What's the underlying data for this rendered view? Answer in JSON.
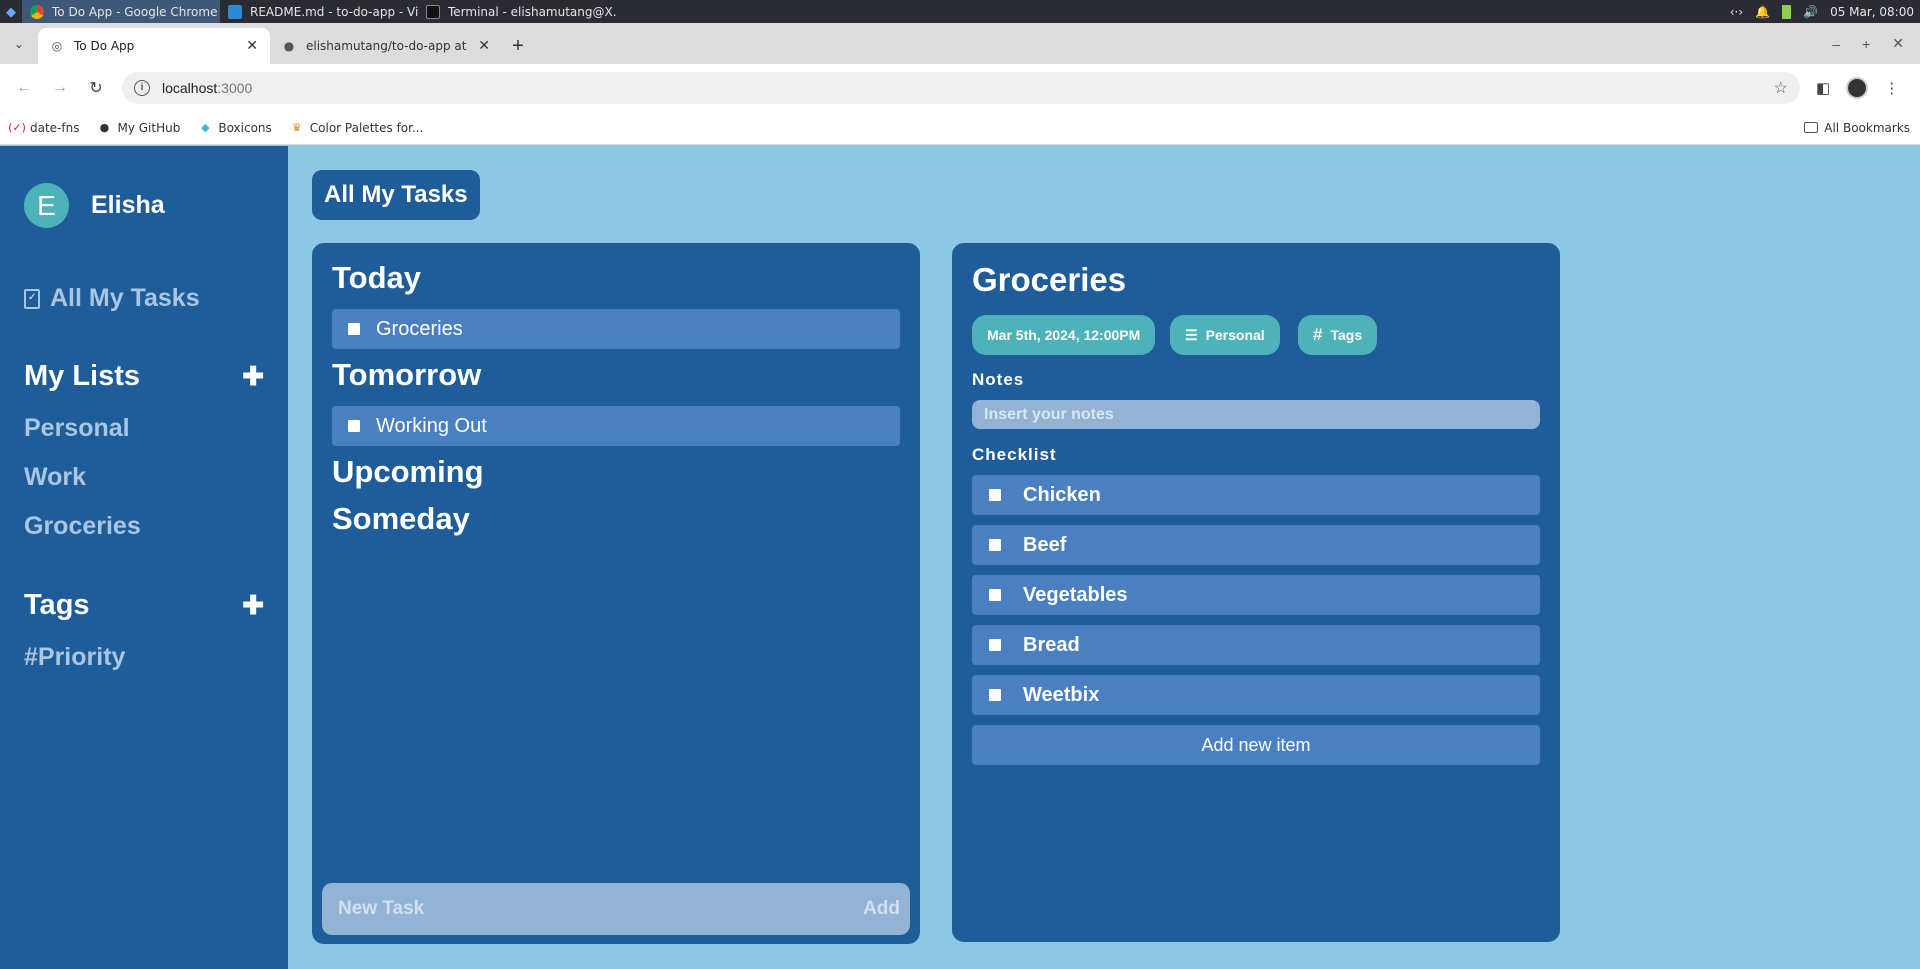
{
  "os": {
    "tasks": [
      {
        "label": "To Do App - Google Chrome",
        "icon": "chrome-icon",
        "active": true
      },
      {
        "label": "README.md - to-do-app - Vi...",
        "icon": "vscode-icon",
        "active": false
      },
      {
        "label": "Terminal - elishamutang@X...",
        "icon": "terminal-icon",
        "active": false
      }
    ],
    "datetime": "05 Mar, 08:00"
  },
  "browser": {
    "tabs": [
      {
        "title": "To Do App",
        "active": true
      },
      {
        "title": "elishamutang/to-do-app at ad",
        "active": false
      }
    ],
    "url_host": "localhost",
    "url_rest": ":3000",
    "bookmarks": [
      {
        "label": "date-fns",
        "icon": "date-fns-icon"
      },
      {
        "label": "My GitHub",
        "icon": "github-icon"
      },
      {
        "label": "Boxicons",
        "icon": "boxicons-icon"
      },
      {
        "label": "Color Palettes for...",
        "icon": "palette-icon"
      }
    ],
    "all_bookmarks": "All Bookmarks"
  },
  "sidebar": {
    "avatar_letter": "E",
    "username": "Elisha",
    "all_tasks": "All My Tasks",
    "lists_heading": "My Lists",
    "lists": [
      "Personal",
      "Work",
      "Groceries"
    ],
    "tags_heading": "Tags",
    "tags": [
      "#Priority"
    ]
  },
  "main": {
    "page_title": "All My Tasks",
    "groups": {
      "today": {
        "title": "Today",
        "tasks": [
          "Groceries"
        ]
      },
      "tomorrow": {
        "title": "Tomorrow",
        "tasks": [
          "Working Out"
        ]
      },
      "upcoming": {
        "title": "Upcoming"
      },
      "someday": {
        "title": "Someday"
      }
    },
    "new_task_placeholder": "New Task",
    "add_label": "Add"
  },
  "detail": {
    "title": "Groceries",
    "date_chip": "Mar 5th, 2024, 12:00PM",
    "list_chip": "Personal",
    "tags_chip": "Tags",
    "notes_label": "Notes",
    "notes_placeholder": "Insert your notes",
    "checklist_label": "Checklist",
    "checklist": [
      "Chicken",
      "Beef",
      "Vegetables",
      "Bread",
      "Weetbix"
    ],
    "add_item_label": "Add new item"
  },
  "colors": {
    "sidebar": "#1f5c9a",
    "background": "#8ec7e3",
    "row": "#4a80c2",
    "accent": "#4db3b8"
  }
}
